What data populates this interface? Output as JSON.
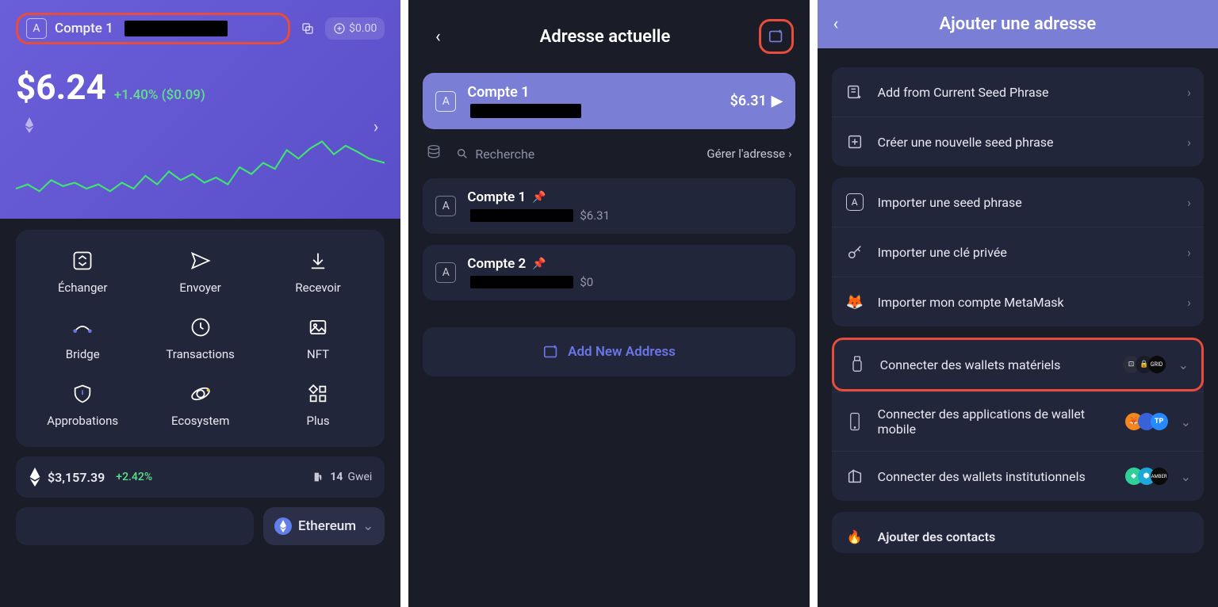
{
  "screen1": {
    "account_label": "Compte 1",
    "gas_chip": "$0.00",
    "balance": "$6.24",
    "delta": "+1.40% ($0.09)",
    "actions": {
      "swap": "Échanger",
      "send": "Envoyer",
      "receive": "Recevoir",
      "bridge": "Bridge",
      "transactions": "Transactions",
      "nft": "NFT",
      "approvals": "Approbations",
      "ecosystem": "Ecosystem",
      "more": "Plus"
    },
    "eth_price": "$3,157.39",
    "eth_pct": "+2.42%",
    "gwei_num": "14",
    "gwei_label": "Gwei",
    "network": "Ethereum"
  },
  "screen2": {
    "title": "Adresse actuelle",
    "active": {
      "name": "Compte 1",
      "balance": "$6.31"
    },
    "search_placeholder": "Recherche",
    "manage_label": "Gérer l'adresse",
    "accounts": [
      {
        "name": "Compte 1",
        "balance": "$6.31"
      },
      {
        "name": "Compte 2",
        "balance": "$0"
      }
    ],
    "add_label": "Add New Address"
  },
  "screen3": {
    "title": "Ajouter une adresse",
    "rows": {
      "add_seed": "Add from Current Seed Phrase",
      "create_seed": "Créer une nouvelle seed phrase",
      "import_seed": "Importer une seed phrase",
      "import_key": "Importer une clé privée",
      "import_mm": "Importer mon compte MetaMask",
      "hardware": "Connecter des wallets matériels",
      "mobile": "Connecter des applications de wallet mobile",
      "institutional": "Connecter des wallets institutionnels",
      "contacts": "Ajouter des contacts"
    }
  }
}
